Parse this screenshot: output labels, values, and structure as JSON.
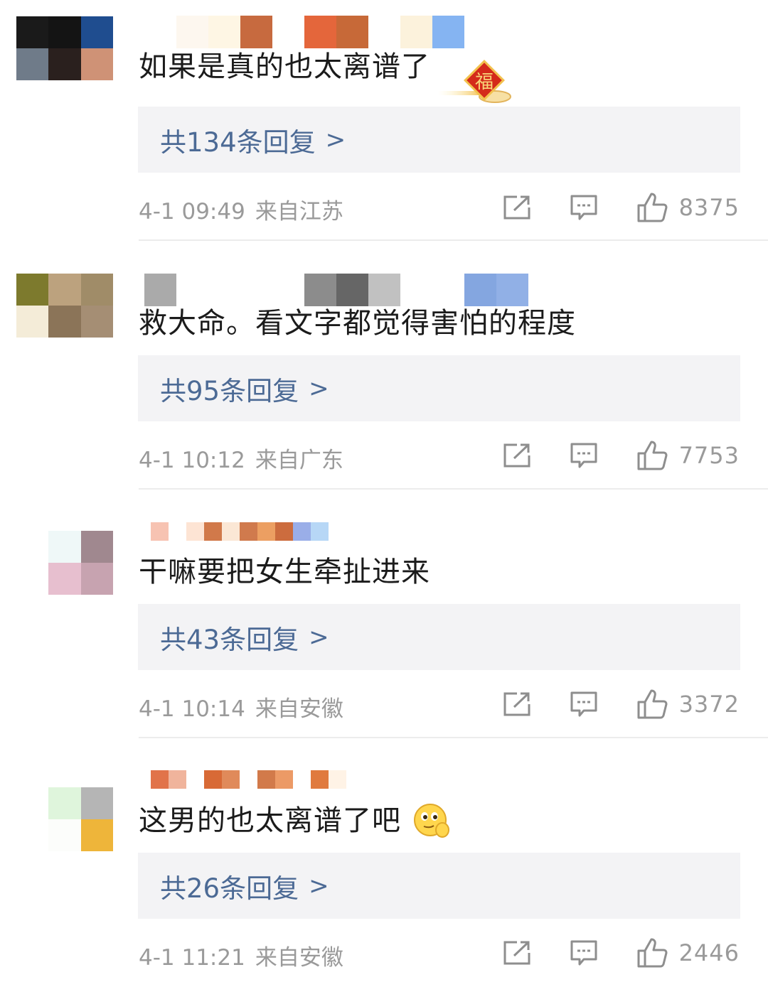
{
  "comments": [
    {
      "avatar_colors": [
        "#1a1a1a",
        "#141414",
        "#1f4d8f",
        "#6f7b89",
        "#2a201e",
        "#cf9276"
      ],
      "name_colors": [
        "#ffffff",
        "#fdf7ef",
        "#fef6e4",
        "#c76a3f",
        "#ffffff",
        "#e4663b",
        "#c76938",
        "#ffffff",
        "#fcf2dc",
        "#85b4f2"
      ],
      "text": "如果是真的也太离谱了",
      "replies": "共134条回复",
      "time": "4-1 09:49",
      "location": "来自江苏",
      "likes": "8375",
      "badge": "福"
    },
    {
      "avatar_colors": [
        "#7d7a2d",
        "#bca27e",
        "#a08c68",
        "#f4ecd8",
        "#8b7458",
        "#a58e74"
      ],
      "name_colors": [
        "#aaaaaa",
        "#ffffff",
        "#ffffff",
        "#ffffff",
        "#ffffff",
        "#8c8c8c",
        "#666666",
        "#c1c1c1",
        "#ffffff",
        "#ffffff",
        "#84a6e0",
        "#91b0e6"
      ],
      "text": "救大命。看文字都觉得害怕的程度",
      "replies": "共95条回复",
      "time": "4-1 10:12",
      "location": "来自广东",
      "likes": "7753"
    },
    {
      "avatar_colors": [
        "#ffffff",
        "#eff8f8",
        "#a0888f",
        "#ffffff",
        "#e7bfcf",
        "#c7a3b0"
      ],
      "name_colors": [
        "#f7c3b2",
        "#ffffff",
        "#fde4d4",
        "#d1794a",
        "#fbe7d5",
        "#d07a4d",
        "#ec9f62",
        "#cc6c3e",
        "#9aaee8",
        "#b7d7f6"
      ],
      "text": "干嘛要把女生牵扯进来",
      "replies": "共43条回复",
      "time": "4-1 10:14",
      "location": "来自安徽",
      "likes": "3372"
    },
    {
      "avatar_colors": [
        "#ffffff",
        "#dff5dc",
        "#b5b5b5",
        "#ffffff",
        "#fcfdfb",
        "#eeb53a"
      ],
      "name_colors": [
        "#e1734a",
        "#f0b49c",
        "#ffffff",
        "#d86a36",
        "#e08a5a",
        "#ffffff",
        "#d27a4a",
        "#ec9a66",
        "#ffffff",
        "#e07a3e",
        "#fff3e6"
      ],
      "text": "这男的也太离谱了吧",
      "replies": "共26条回复",
      "time": "4-1 11:21",
      "location": "来自安徽",
      "likes": "2446",
      "emoji": "smirk-face"
    }
  ],
  "reply_chevron": ">",
  "colors": {
    "link": "#4c6a95",
    "meta": "#9a9a9a",
    "reply_bg": "#f3f3f5"
  }
}
